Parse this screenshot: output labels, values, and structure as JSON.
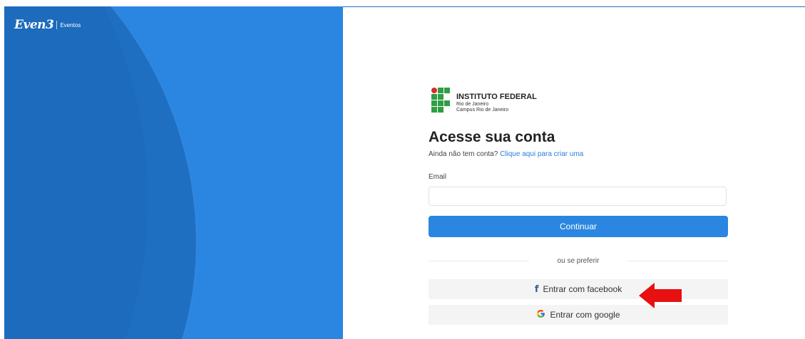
{
  "brand": {
    "logo": "Even3",
    "section": "Eventos"
  },
  "institution": {
    "name": "INSTITUTO FEDERAL",
    "line2": "Rio de Janeiro",
    "line3": "Campus Rio de Janeiro"
  },
  "login": {
    "title": "Acesse sua conta",
    "signup_prompt": "Ainda não tem conta?",
    "signup_link": "Clique aqui para criar uma",
    "email_label": "Email",
    "email_value": "",
    "continue_label": "Continuar",
    "divider_text": "ou se preferir",
    "facebook_label": "Entrar com facebook",
    "google_label": "Entrar com google"
  },
  "annotation": {
    "arrow_color": "#e81010",
    "points_to": "facebook-login-button"
  },
  "colors": {
    "primary": "#2a86e0",
    "panel_dark": "#1e6fc2",
    "link": "#2a7de1"
  },
  "icons": [
    "facebook-icon",
    "google-icon",
    "institution-logo-icon"
  ]
}
